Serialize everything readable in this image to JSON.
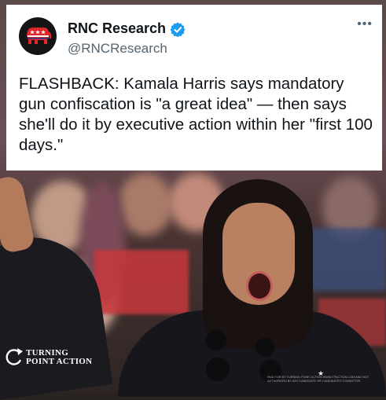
{
  "tweet": {
    "display_name": "RNC Research",
    "handle": "@RNCResearch",
    "verified": true,
    "more_label": "•••",
    "text": "FLASHBACK: Kamala Harris says mandatory gun confiscation is \"a great idea\" — then says she'll do it by executive action within her \"first 100 days.\""
  },
  "watermark": {
    "line1": "TURNING",
    "line2": "POINT ACTION",
    "disclaimer": "PAID FOR BY TURNING POINT ACTION WWW.TPACTION.COM AND NOT AUTHORIZED BY ANY CANDIDATE OR CANDIDATE'S COMMITTEE"
  },
  "colors": {
    "verified_blue": "#1d9bf0",
    "rnc_red": "#e0262b",
    "text_primary": "#0f1419",
    "text_secondary": "#536471"
  },
  "icons": {
    "avatar": "rnc-elephant-icon",
    "verified": "verified-badge-icon",
    "more": "more-options-icon",
    "watermark_logo": "turning-point-arrow-icon"
  }
}
